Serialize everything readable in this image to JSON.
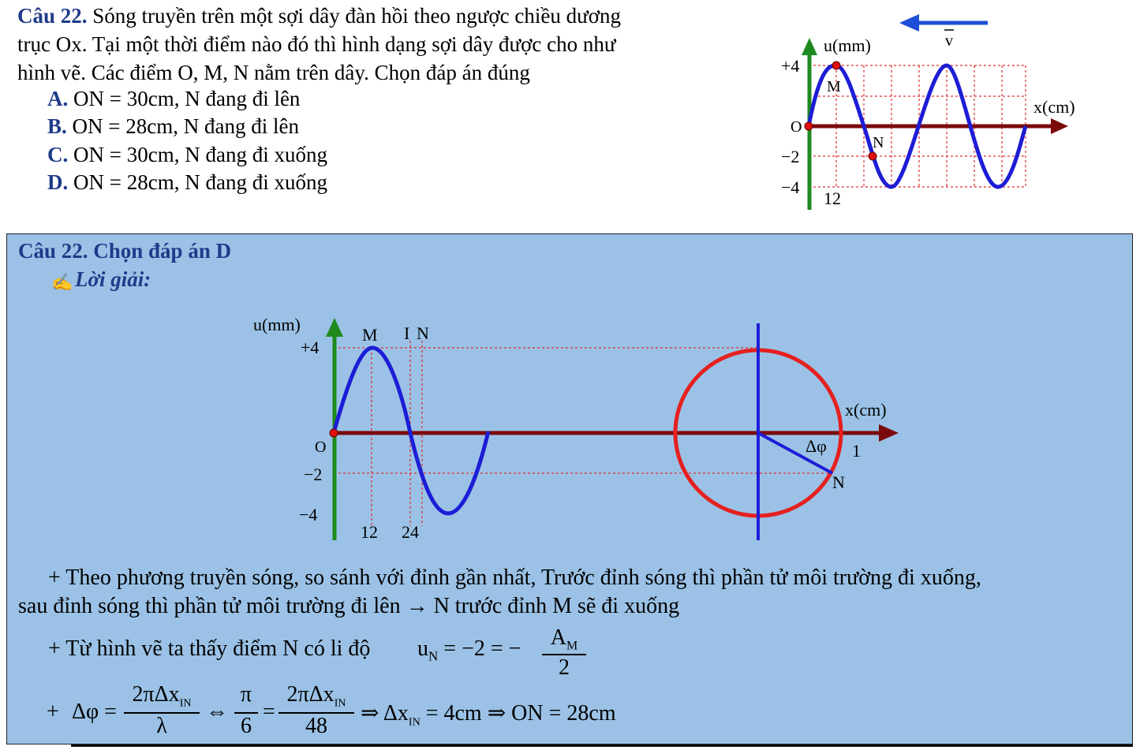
{
  "question": {
    "label": "Câu 22.",
    "line1": "Sóng truyền trên một sợi dây đàn hồi theo ngược chiều dương",
    "line2": "trục Ox. Tại một thời điểm nào đó thì hình dạng sợi dây được cho như",
    "line3": "hình vẽ. Các điểm O, M, N nằm trên dây. Chọn đáp án đúng",
    "options": [
      {
        "letter": "A.",
        "text": "ON = 30cm, N đang đi lên"
      },
      {
        "letter": "B.",
        "text": "ON = 28cm, N đang đi lên"
      },
      {
        "letter": "C.",
        "text": "ON = 30cm, N đang đi xuống"
      },
      {
        "letter": "D.",
        "text": "ON = 28cm, N đang đi xuống"
      }
    ]
  },
  "figure1": {
    "y_axis": "u(mm)",
    "x_axis": "x(cm)",
    "velocity": "v",
    "tick_plus4": "+4",
    "tick_0": "O",
    "tick_minus2": "−2",
    "tick_minus4": "−4",
    "tick_12": "12",
    "point_m": "M",
    "point_n": "N"
  },
  "solution": {
    "title": "Câu 22. Chọn đáp án D",
    "subtitle": "Lời giải:",
    "pencil_icon": "✍",
    "figure2": {
      "y_axis": "u(mm)",
      "x_axis": "x(cm)",
      "tick_plus4": "+4",
      "tick_0": "O",
      "tick_minus2": "−2",
      "tick_minus4": "−4",
      "tick_12": "12",
      "tick_24": "24",
      "label_m": "M",
      "label_i": "I",
      "label_n": "N",
      "circle_n": "N",
      "dphi": "Δφ",
      "circle_one": "1"
    },
    "para1_line1": "+ Theo phương truyền sóng, so sánh với đỉnh gần nhất, Trước đỉnh sóng thì phần tử môi trường đi xuống,",
    "para1_line2": "sau đỉnh sóng thì phần tử môi trường đi lên → N trước đỉnh M sẽ đi xuống",
    "para2_text": "+ Từ hình vẽ ta thấy điểm N có li độ",
    "para2_formula": {
      "u": "u",
      "u_sub": "N",
      "eq": "= −2 = −",
      "num": "A",
      "num_sub": "M",
      "den": "2"
    },
    "para3_formula": {
      "plus": "+",
      "dphi": "Δφ =",
      "f1_num": "2πΔx",
      "f1_num_sub": "IN",
      "f1_den": "λ",
      "equiv": "⇔",
      "f2_num": "π",
      "f2_den": "6",
      "eq": "=",
      "f3_num": "2πΔx",
      "f3_num_sub": "IN",
      "f3_den": "48",
      "rest1": "⇒ Δx",
      "rest1_sub": "IN",
      "rest2": "= 4cm ⇒ ON = 28cm"
    }
  }
}
